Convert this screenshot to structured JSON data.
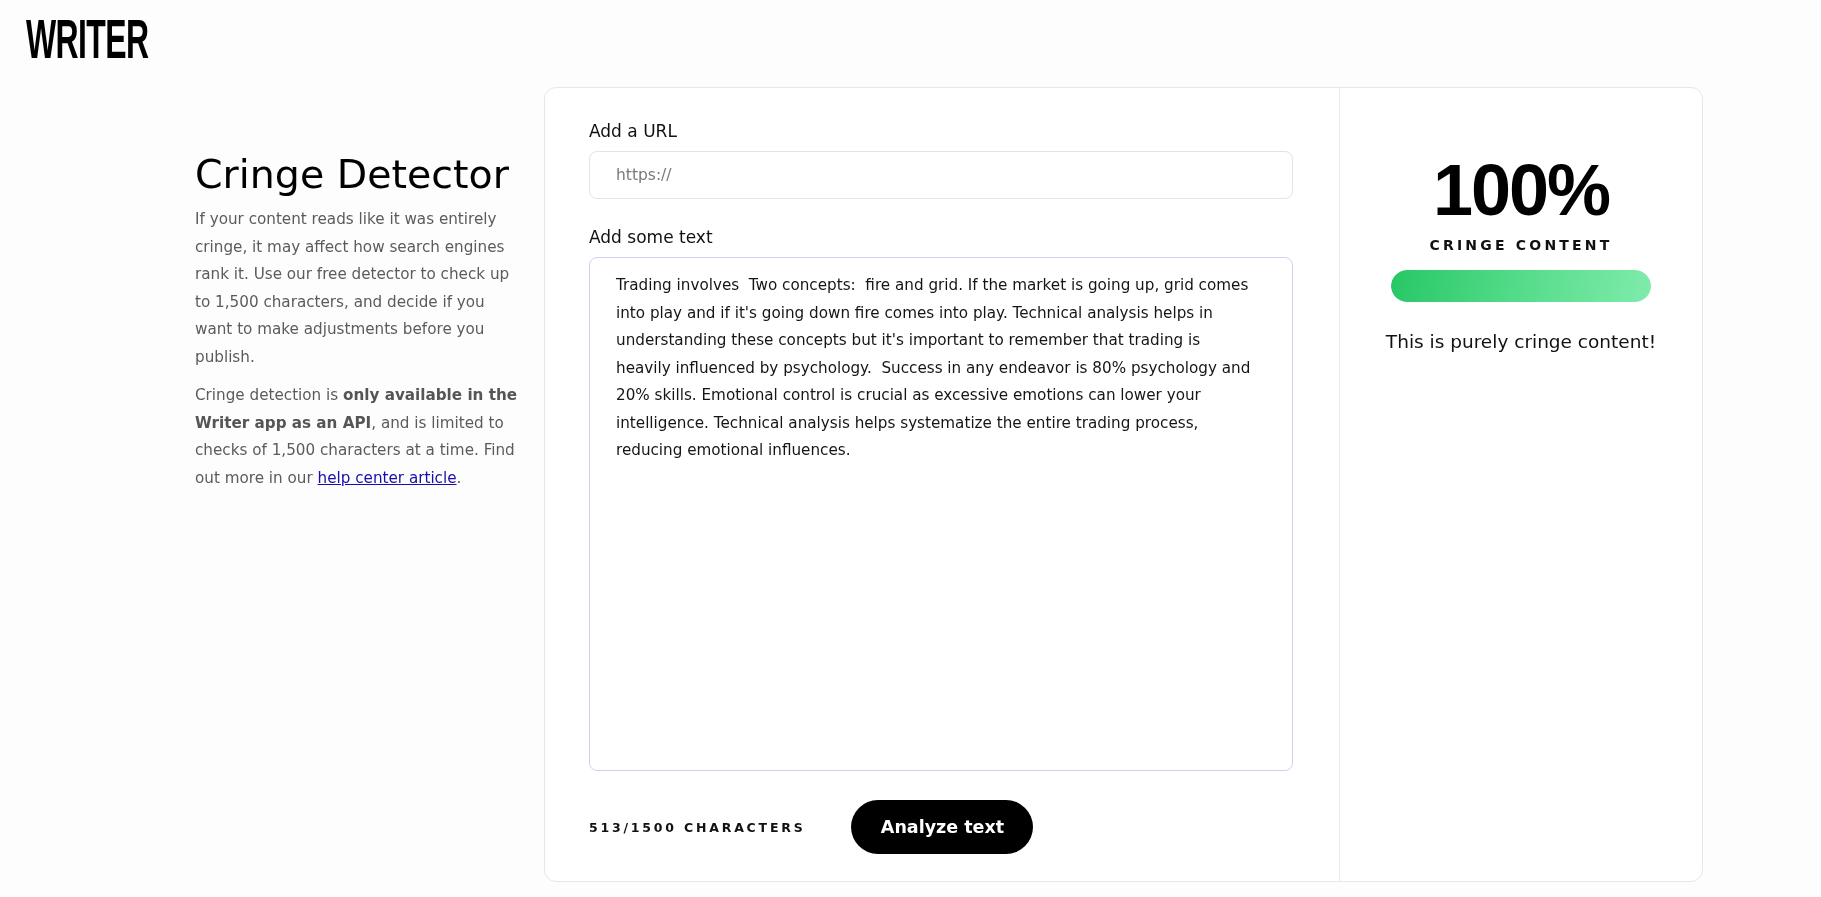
{
  "logo": {
    "text": "WRITER"
  },
  "intro": {
    "title": "Cringe Detector",
    "description": "If your content reads like it was entirely cringe, it may affect how search engines rank it. Use our free detector to check up to 1,500 characters, and decide if you want to make adjustments before you publish.",
    "note": {
      "text": "Cringe detection is **only available in the Writer app as an API**, and is limited to checks of 1,500 characters at a time. Find out more in our",
      "link": "help center article",
      "end": "."
    }
  },
  "form": {
    "url_field": {
      "label": "Add a URL",
      "placeholder": "https://"
    },
    "text_field": {
      "label": "Add some text",
      "value": "Trading involves  Two concepts:  fire and grid. If the market is going up, grid comes into play and if it's going down fire comes into play. Technical analysis helps in understanding these concepts but it's important to remember that trading is heavily influenced by psychology.  Success in any endeavor is 80% psychology and 20% skills. Emotional control is crucial as excessive emotions can lower your intelligence. Technical analysis helps systematize the entire trading process, reducing emotional influences."
    },
    "character_count": "513/1500 CHARACTERS",
    "submit_button": "Analyze text"
  },
  "result": {
    "score": "100%",
    "score_label": "CRINGE CONTENT",
    "meter": {
      "level": 1
    },
    "message": "This is purely cringe content!"
  }
}
